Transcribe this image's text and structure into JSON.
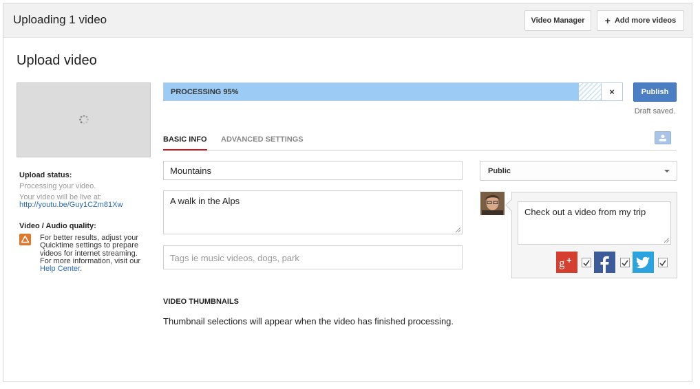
{
  "header": {
    "title": "Uploading 1 video",
    "video_manager_label": "Video Manager",
    "add_more_label": "Add more videos"
  },
  "page": {
    "title": "Upload video"
  },
  "sidebar": {
    "upload_status_label": "Upload status:",
    "processing_text": "Processing your video.",
    "live_text": "Your video will be live at:",
    "video_url": "http://youtu.be/Guy1CZm81Xw",
    "quality_label": "Video / Audio quality:",
    "quality_text": "For better results, adjust your Quicktime settings to prepare videos for internet streaming. For more information, visit our",
    "help_center_label": "Help Center",
    "help_center_suffix": "."
  },
  "progress": {
    "label": "PROCESSING 95%",
    "percent": 95,
    "cancel_label": "×"
  },
  "publish_label": "Publish",
  "draft_status": "Draft saved.",
  "tabs": [
    {
      "label": "BASIC INFO",
      "active": true
    },
    {
      "label": "ADVANCED SETTINGS",
      "active": false
    }
  ],
  "form": {
    "title_value": "Mountains",
    "description_value": "A walk in the Alps",
    "tags_placeholder": "Tags ie music videos, dogs, park",
    "privacy_value": "Public"
  },
  "share": {
    "message": "Check out a video from my trip",
    "networks": [
      {
        "name": "Google+",
        "icon": "google-plus-icon",
        "color": "#d43f2f",
        "checked": true
      },
      {
        "name": "Facebook",
        "icon": "facebook-icon",
        "color": "#3c5b9a",
        "checked": true
      },
      {
        "name": "Twitter",
        "icon": "twitter-icon",
        "color": "#2aa3de",
        "checked": true
      }
    ]
  },
  "thumbnails": {
    "title": "VIDEO THUMBNAILS",
    "text": "Thumbnail selections will appear when the video has finished processing."
  },
  "colors": {
    "accent_red": "#cc181e",
    "progress_blue": "#9cccf5",
    "publish_blue": "#4c7ec4",
    "link_blue": "#2a6bb6",
    "warning_orange": "#e0772a"
  }
}
